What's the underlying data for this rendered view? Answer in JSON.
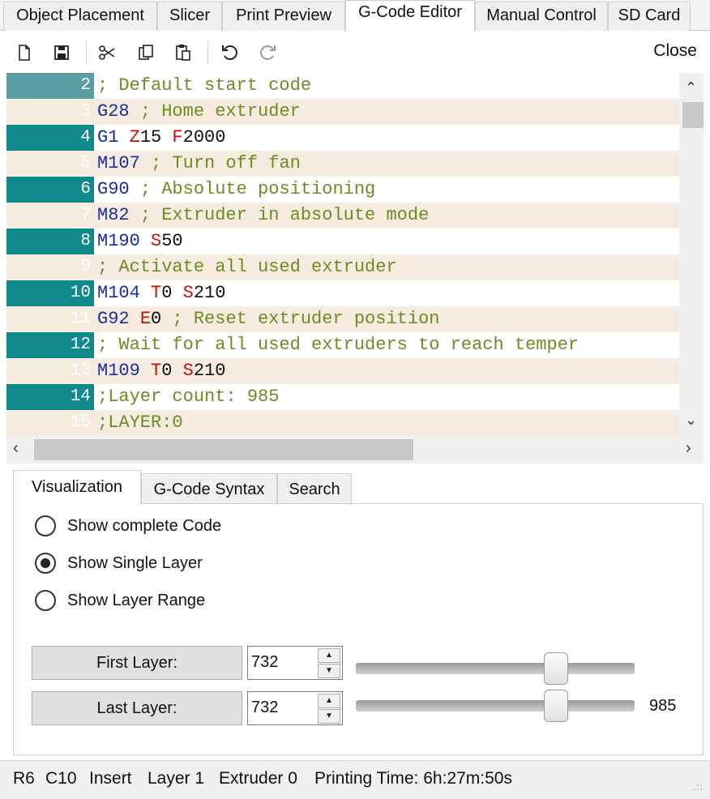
{
  "top_tabs": [
    {
      "label": "Object Placement"
    },
    {
      "label": "Slicer"
    },
    {
      "label": "Print Preview"
    },
    {
      "label": "G-Code Editor",
      "active": true
    },
    {
      "label": "Manual Control"
    },
    {
      "label": "SD Card"
    }
  ],
  "toolbar": {
    "icons": [
      "new-file-icon",
      "save-icon",
      "cut-icon",
      "copy-icon",
      "paste-icon",
      "undo-icon",
      "redo-icon"
    ],
    "close_label": "Close"
  },
  "editor": {
    "lines": [
      {
        "n": "2",
        "text": "; Default start code"
      },
      {
        "n": "3",
        "text": "G28 ; Home extruder"
      },
      {
        "n": "4",
        "text": "G1 Z15 F2000"
      },
      {
        "n": "5",
        "text": "M107 ; Turn off fan"
      },
      {
        "n": "6",
        "text": "G90 ; Absolute positioning"
      },
      {
        "n": "7",
        "text": "M82 ; Extruder in absolute mode"
      },
      {
        "n": "8",
        "text": "M190 S50"
      },
      {
        "n": "9",
        "text": "; Activate all used extruder"
      },
      {
        "n": "10",
        "text": "M104 T0 S210"
      },
      {
        "n": "11",
        "text": "G92 E0 ; Reset extruder position"
      },
      {
        "n": "12",
        "text": "; Wait for all used extruders to reach temper"
      },
      {
        "n": "13",
        "text": "M109 T0 S210"
      },
      {
        "n": "14",
        "text": ";Layer count: 985"
      },
      {
        "n": "15",
        "text": ";LAYER:0"
      }
    ],
    "colors": {
      "gutter": "#108a8a",
      "comment": "#6b8e23",
      "command": "#1a2fa0",
      "param": "#c01010",
      "alt_row": "#f5ebdf"
    }
  },
  "sub_tabs": [
    {
      "label": "Visualization",
      "active": true
    },
    {
      "label": "G-Code Syntax"
    },
    {
      "label": "Search"
    }
  ],
  "visualization": {
    "options": [
      {
        "label": "Show complete Code",
        "checked": false
      },
      {
        "label": "Show Single Layer",
        "checked": true
      },
      {
        "label": "Show Layer Range",
        "checked": false
      }
    ],
    "first_layer": {
      "label": "First Layer:",
      "value": "732"
    },
    "last_layer": {
      "label": "Last Layer:",
      "value": "732"
    },
    "max_layer": "985"
  },
  "status": {
    "row": "R6",
    "col": "C10",
    "mode": "Insert",
    "layer": "Layer 1",
    "extruder": "Extruder 0",
    "printing_time": "Printing Time: 6h:27m:50s"
  }
}
